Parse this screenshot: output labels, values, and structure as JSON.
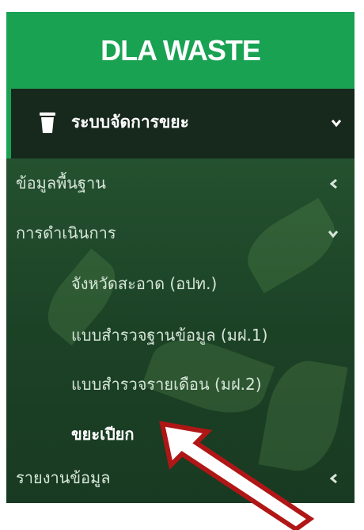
{
  "brand": {
    "title": "DLA WASTE"
  },
  "menu": {
    "active_parent": {
      "label": "ระบบจัดการขยะ",
      "icon": "trash-icon",
      "chevron": "chevron-down-icon"
    },
    "groups": [
      {
        "label": "ข้อมูลพื้นฐาน",
        "chevron": "chevron-left-icon"
      },
      {
        "label": "การดำเนินการ",
        "chevron": "chevron-down-icon",
        "children": [
          {
            "label": "จังหวัดสะอาด (อปท.)"
          },
          {
            "label": "แบบสำรวจฐานข้อมูล (มฝ.1)"
          },
          {
            "label": "แบบสำรวจรายเดือน (มฝ.2)"
          },
          {
            "label": "ขยะเปียก",
            "current": true
          }
        ]
      },
      {
        "label": "รายงานข้อมูล",
        "chevron": "chevron-left-icon"
      }
    ]
  },
  "colors": {
    "brand_green": "#1aa253",
    "active_bg": "#17281c",
    "annotation_arrow": "#b01616"
  }
}
